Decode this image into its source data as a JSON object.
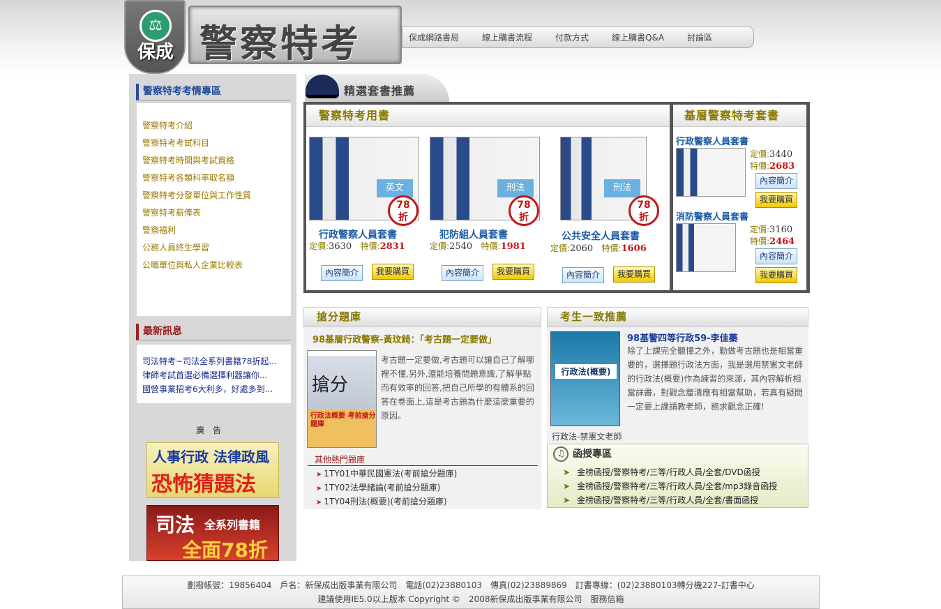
{
  "header": {
    "logo_text": "保成",
    "banner_text": "警察特考",
    "nav": [
      "保成網路書局",
      "線上購書流程",
      "付款方式",
      "線上購書Q&A",
      "討論區"
    ]
  },
  "sidebar": {
    "info_title": "警察特考考情專區",
    "info_links": [
      "警察特考介紹",
      "警察特考考試科目",
      "警察特考時間與考試資格",
      "警察特考各類科率取名額",
      "警察特考分發單位與工作性質",
      "警察特考薪俸表",
      "警察福利",
      "公務人員終生學習",
      "公職單位與私人企業比較表"
    ],
    "news_title": "最新訊息",
    "news_links": [
      "司法特考~司法全系列書籍78折起...",
      "律師考試首選必備選擇利器讓你...",
      "國營事業招考6大利多，好處多到..."
    ],
    "ad_label": "廣告",
    "ad1": {
      "line1": "人事行政 法律政風",
      "line2": "恐怖猜題法"
    },
    "ad2": {
      "line1": "司法",
      "line2": "全系列書籍",
      "line3": "全面78折"
    }
  },
  "featured": {
    "title": "精選套書推薦",
    "police_title": "警察特考用書",
    "discount": "78",
    "discount_suffix": "折",
    "books": [
      {
        "name": "行政警察人員套書",
        "list_label": "定價:",
        "list": "3630",
        "special_label": "特價:",
        "special": "2831",
        "cover": "英文"
      },
      {
        "name": "犯防組人員套書",
        "list_label": "定價:",
        "list": "2540",
        "special_label": "特價:",
        "special": "1981",
        "cover": "刑法"
      },
      {
        "name": "公共安全人員套書",
        "list_label": "定價:",
        "list": "2060",
        "special_label": "特價:",
        "special": "1606",
        "cover": "刑法"
      }
    ],
    "info_btn": "內容簡介",
    "buy_btn": "我要購買",
    "basic_title": "基層警察特考套書",
    "basic_sets": [
      {
        "name": "行政警察人員套書",
        "list_label": "定價:",
        "list": "3440",
        "special_label": "特價:",
        "special": "2683"
      },
      {
        "name": "消防警察人員套書",
        "list_label": "定價:",
        "list": "3160",
        "special_label": "特價:",
        "special": "2464"
      }
    ]
  },
  "quiz": {
    "title": "搶分題庫",
    "headline": "98基層行政警察-黃玟錡：「考古題一定要做」",
    "cover_title": "搶分",
    "cover_sub": "行政法概要 考前搶分題庫",
    "text": "考古題一定要做,考古題可以讓自己了解哪裡不懂,另外,還能培養問題意識,了解爭點而有效率的回答,把自己所學的有體系的回答在卷面上,這是考古題為什麼這麼重要的原因。",
    "hot_title": "其他熱門題庫",
    "hot_links": [
      "1TY01中華民國憲法(考前搶分題庫)",
      "1TY02法學緒論(考前搶分題庫)",
      "1TY04刑法(概要)(考前搶分題庫)"
    ]
  },
  "recommend": {
    "title": "考生一致推薦",
    "name": "98基警四等行政59-李佳蓁",
    "cover_title": "行政法(概要)",
    "text": "除了上課完全聽懂之外，勤做考古題也是相當重要的，選擇題行政法方面，我是選用禁憲文老師的行政法(概要)作為練習的來源，其內容解析相當詳盡，對觀念釐清應有相當幫助，若真有疑問一定要上課請教老師，務求觀念正確!",
    "caption": "行政法-禁憲文老師"
  },
  "correspondence": {
    "title": "函授專區",
    "links": [
      "金榜函授/警察特考/三等/行政人員/全套/DVD函授",
      "金榜函授/警察特考/三等/行政人員/全套/mp3錄音函授",
      "金榜函授/警察特考/三等/行政人員/全套/書面函授"
    ]
  },
  "footer": {
    "line1": "劃撥帳號：19856404　戶名：新保成出版事業有限公司　電話(02)23880103　傳真(02)23889869　訂書專線：(02)23880103轉分機227-訂書中心",
    "line2": "建議使用IE5.0以上版本 Copyright ©　2008新保成出版事業有限公司　服務信箱"
  }
}
